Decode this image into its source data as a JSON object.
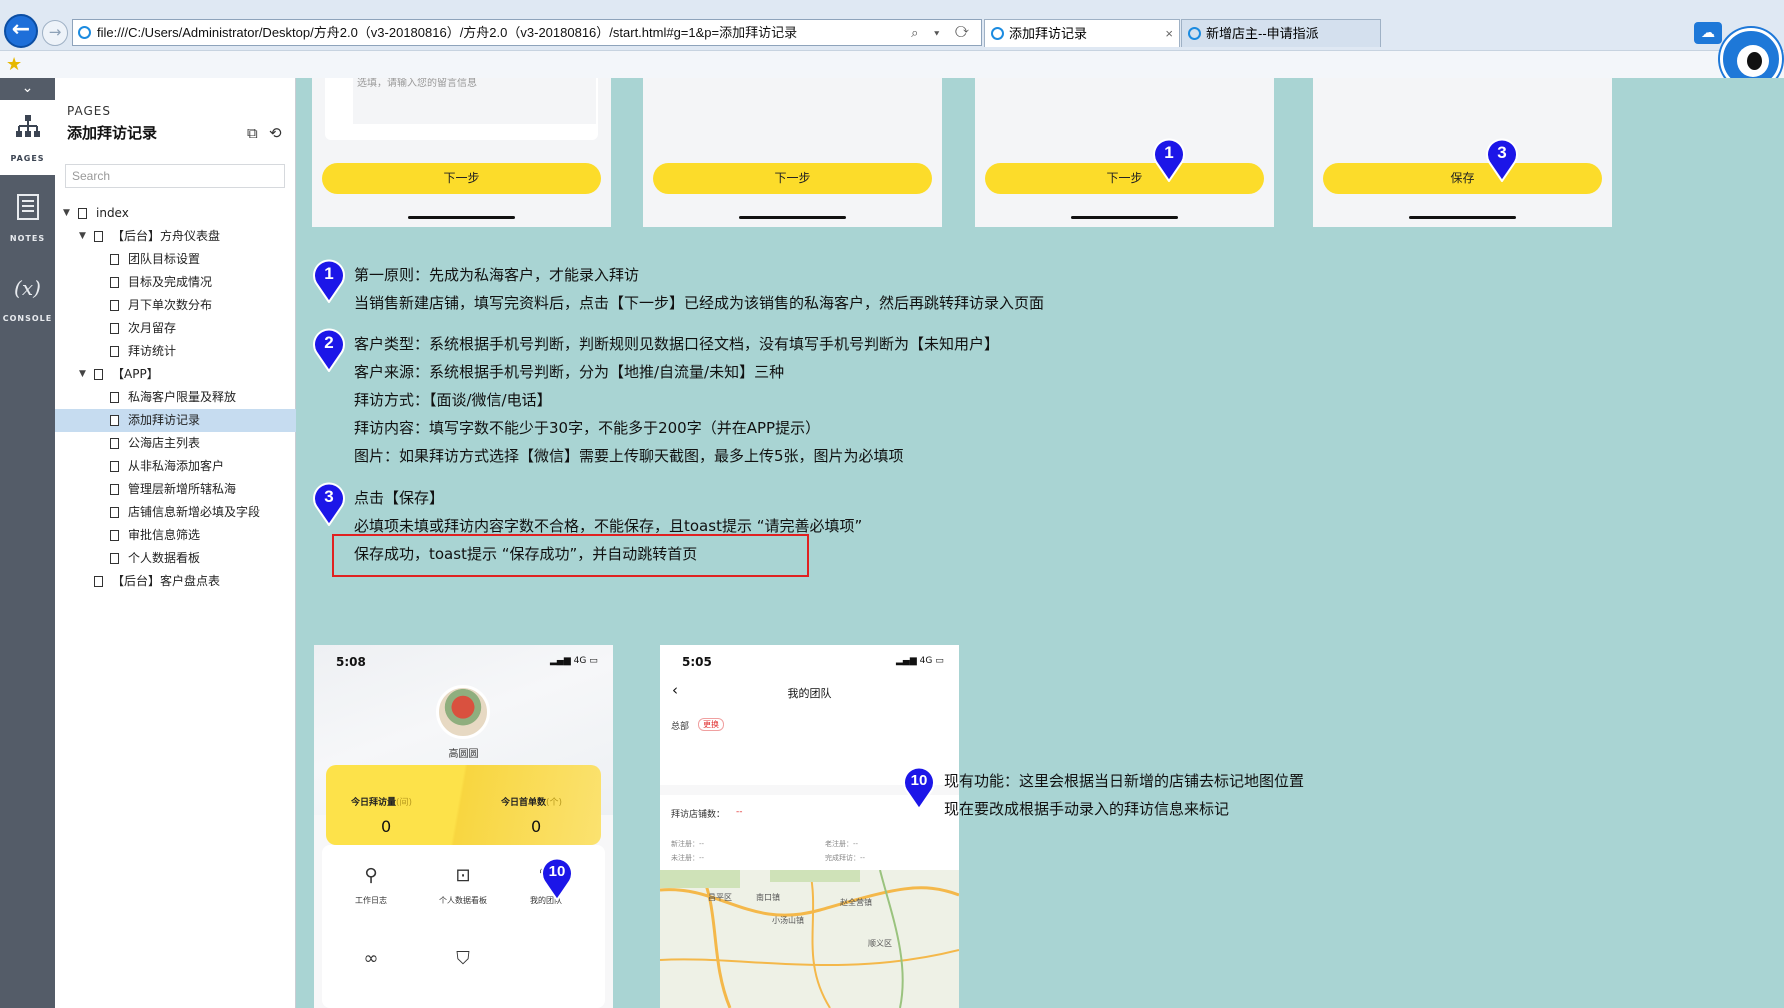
{
  "browser": {
    "address": "file:///C:/Users/Administrator/Desktop/方舟2.0（v3-20180816）/方舟2.0（v3-20180816）/start.html#g=1&p=添加拜访记录",
    "address_tools": "⌕ ▾ ⟳",
    "tabs": [
      {
        "label": "添加拜访记录",
        "close": "×"
      },
      {
        "label": "新增店主--申请指派"
      }
    ]
  },
  "rail": {
    "toggle": "⌄",
    "items": [
      {
        "label": "PAGES",
        "icon": "sitemap-icon"
      },
      {
        "label": "NOTES",
        "icon": "notes-icon"
      },
      {
        "label": "CONSOLE",
        "icon": "console-icon",
        "glyph": "(x)"
      }
    ]
  },
  "panel": {
    "kicker": "PAGES",
    "title": "添加拜访记录",
    "search_placeholder": "Search",
    "tree": [
      {
        "label": "index",
        "level": 0,
        "expanded": true
      },
      {
        "label": "【后台】方舟仪表盘",
        "level": 1,
        "expanded": true
      },
      {
        "label": "团队目标设置",
        "level": 2
      },
      {
        "label": "目标及完成情况",
        "level": 2
      },
      {
        "label": "月下单次数分布",
        "level": 2
      },
      {
        "label": "次月留存",
        "level": 2
      },
      {
        "label": "拜访统计",
        "level": 2
      },
      {
        "label": "【APP】",
        "level": 1,
        "expanded": true
      },
      {
        "label": "私海客户限量及释放",
        "level": 2
      },
      {
        "label": "添加拜访记录",
        "level": 2,
        "selected": true
      },
      {
        "label": "公海店主列表",
        "level": 2
      },
      {
        "label": "从非私海添加客户",
        "level": 2
      },
      {
        "label": "管理层新增所辖私海",
        "level": 2
      },
      {
        "label": "店铺信息新增必填及字段",
        "level": 2
      },
      {
        "label": "审批信息筛选",
        "level": 2
      },
      {
        "label": "个人数据看板",
        "level": 2
      },
      {
        "label": "【后台】客户盘点表",
        "level": 1
      }
    ]
  },
  "screens": [
    {
      "note": "选填，请输入您的留言信息",
      "button": "下一步"
    },
    {
      "button": "下一步"
    },
    {
      "button": "下一步",
      "pin": "1"
    },
    {
      "button": "保存",
      "pin": "3"
    }
  ],
  "annotations": {
    "a1": {
      "pin": "1",
      "lines": [
        "第一原则：先成为私海客户，才能录入拜访",
        "当销售新建店铺，填写完资料后，点击【下一步】已经成为该销售的私海客户，然后再跳转拜访录入页面"
      ]
    },
    "a2": {
      "pin": "2",
      "lines": [
        "客户类型：系统根据手机号判断，判断规则见数据口径文档，没有填写手机号判断为【未知用户】",
        "客户来源：系统根据手机号判断，分为【地推/自流量/未知】三种",
        "拜访方式：【面谈/微信/电话】",
        "拜访内容：填写字数不能少于30字，不能多于200字（并在APP提示）",
        "图片：如果拜访方式选择【微信】需要上传聊天截图，最多上传5张，图片为必填项"
      ]
    },
    "a3": {
      "pin": "3",
      "lines": [
        "点击【保存】",
        "必填项未填或拜访内容字数不合格，不能保存，且toast提示 “请完善必填项”",
        "保存成功，toast提示 “保存成功”，并自动跳转首页"
      ]
    },
    "a10": {
      "pin": "10",
      "lines": [
        "现有功能：这里会根据当日新增的店铺去标记地图位置",
        "现在要改成根据手动录入的拜访信息来标记"
      ]
    }
  },
  "phone1": {
    "time": "5:08",
    "signal": "4G",
    "name": "高圆圆",
    "stats": [
      {
        "label": "今日拜访量",
        "unit": "(间)",
        "value": "0"
      },
      {
        "label": "今日首单数",
        "unit": "(个)",
        "value": "0"
      }
    ],
    "menu": [
      {
        "label": "工作日志",
        "icon": "bulb-icon"
      },
      {
        "label": "个人数据看板",
        "icon": "chart-icon"
      },
      {
        "label": "我的团队",
        "icon": "team-icon"
      }
    ],
    "pin": "10"
  },
  "phone2": {
    "time": "5:05",
    "signal": "4G",
    "title": "我的团队",
    "dept": "总部",
    "badge": "更换",
    "visit_label": "拜访店铺数：",
    "visit_value": "--",
    "minis": [
      "新注册：--",
      "老注册：--",
      "未注册：--",
      "完成拜访：--"
    ],
    "map_labels": [
      "昌平区",
      "南口镇",
      "小汤山镇",
      "赵全营镇",
      "顺义区"
    ]
  },
  "colors": {
    "canvas": "#a9d4d3",
    "button_yellow": "#fcdc2a",
    "pin_blue": "#1c16e8",
    "highlight": "#e02121"
  }
}
